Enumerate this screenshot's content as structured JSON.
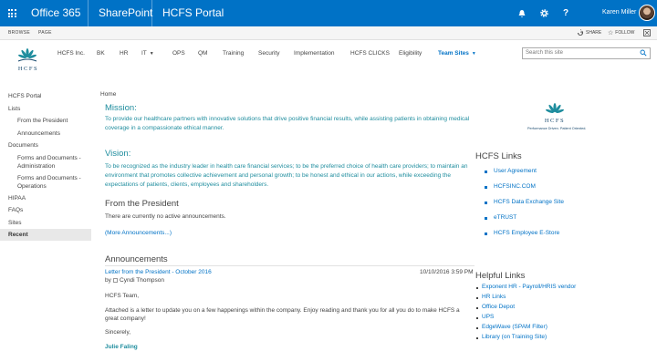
{
  "suitebar": {
    "brand": "Office 365",
    "app": "SharePoint",
    "site": "HCFS Portal",
    "user": "Karen Miller",
    "icons": [
      "app-launcher-icon",
      "bell-icon",
      "gear-icon",
      "help-icon"
    ]
  },
  "ribbon": {
    "tabs": [
      "BROWSE",
      "PAGE"
    ],
    "share": "SHARE",
    "follow": "FOLLOW"
  },
  "logo": {
    "word": "HCFS"
  },
  "topnav": {
    "items": [
      "HCFS Inc.",
      "BK",
      "HR",
      "IT",
      "OPS",
      "QM",
      "Training",
      "Security",
      "Implementation",
      "HCFS CLICKS",
      "Eligibility",
      "Team Sites"
    ],
    "active": "Team Sites"
  },
  "search": {
    "placeholder": "Search this site"
  },
  "leftnav": {
    "items": [
      "HCFS Portal",
      "Lists",
      "From the President",
      "Announcements",
      "Documents",
      "Forms and Documents -",
      "Administration",
      "Forms and Documents -",
      "Operations",
      "HIPAA",
      "FAQs",
      "Sites"
    ],
    "recent": "Recent"
  },
  "main": {
    "breadcrumb": "Home",
    "mission_title": "Mission:",
    "mission_text_1": "To provide our healthcare partners with innovative solutions that drive positive financial results, while assisting patients in obtaining medical",
    "mission_text_2": "coverage in a compassionate ethical manner.",
    "vision_title": "Vision:",
    "vision_text_1": "To be recognized as the industry leader in health care financial services; to be the preferred choice of health care providers; to maintain an",
    "vision_text_2": "environment that promotes collective achievement and personal growth; to be honest and ethical in our actions, while exceeding the",
    "vision_text_3": "expectations of patients, clients, employees and shareholders.",
    "president_title": "From the President",
    "president_empty": "There are currently no active announcements.",
    "more_announcements": "(More Announcements...)",
    "announcements_title": "Announcements",
    "letter_title": "Letter from the President - October 2016",
    "letter_date": "10/10/2016 3:59 PM",
    "letter_by": "by",
    "letter_author": "Cyndi Thompson",
    "body_1": "HCFS Team,",
    "body_2a": "Attached is a letter to update you on a few happenings within the company.     Enjoy reading and thank you for all you do to make HCFS a",
    "body_2b": "great company!",
    "body_3": "Sincerely,",
    "signature": "Julie Faling"
  },
  "right": {
    "tagline": "Performance Driven. Patient Oriented.",
    "links_title": "HCFS Links",
    "links": [
      "User Agreement",
      "HCFSINC.COM",
      "HCFS Data Exchange Site",
      "eTRUST",
      "HCFS Employee E-Store"
    ],
    "helpful_title": "Helpful Links",
    "helpful": [
      "Exponent HR - Payroll/HRIS vendor",
      "HR Links",
      "Office Depot",
      "UPS",
      "EdgeWave (SPAM Filter)",
      "Library (on Training Site)"
    ]
  },
  "colors": {
    "suitebar": "#0072c6",
    "link": "#0072c6",
    "heading_teal": "#1f8d9e"
  }
}
